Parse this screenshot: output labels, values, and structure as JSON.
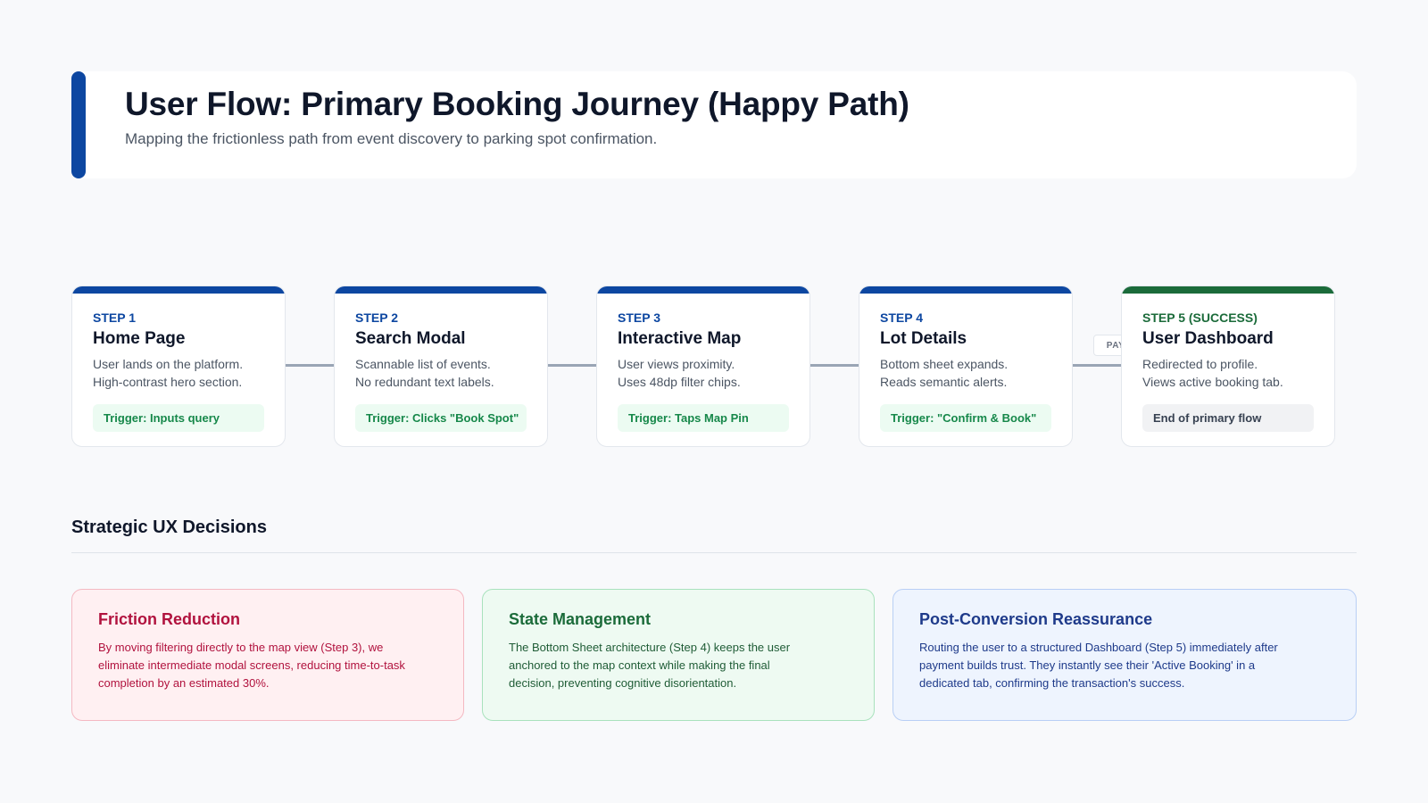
{
  "header": {
    "title": "User Flow: Primary Booking Journey (Happy Path)",
    "subtitle": "Mapping the frictionless path from event discovery to parking spot confirmation."
  },
  "flow": {
    "connector_label": "PAY",
    "steps": [
      {
        "label": "STEP 1",
        "title": "Home Page",
        "desc_line1": "User lands on the platform.",
        "desc_line2": "High-contrast hero section.",
        "trigger": "Trigger: Inputs query"
      },
      {
        "label": "STEP 2",
        "title": "Search Modal",
        "desc_line1": "Scannable list of events.",
        "desc_line2": "No redundant text labels.",
        "trigger": "Trigger: Clicks \"Book Spot\""
      },
      {
        "label": "STEP 3",
        "title": "Interactive Map",
        "desc_line1": "User views proximity.",
        "desc_line2": "Uses 48dp filter chips.",
        "trigger": "Trigger: Taps Map Pin"
      },
      {
        "label": "STEP 4",
        "title": "Lot Details",
        "desc_line1": "Bottom sheet expands.",
        "desc_line2": "Reads semantic alerts.",
        "trigger": "Trigger: \"Confirm & Book\""
      },
      {
        "label": "STEP 5 (SUCCESS)",
        "title": "User Dashboard",
        "desc_line1": "Redirected to profile.",
        "desc_line2": "Views active booking tab.",
        "trigger": "End of primary flow"
      }
    ]
  },
  "decisions": {
    "title": "Strategic UX Decisions",
    "cards": [
      {
        "title": "Friction Reduction",
        "text": "By moving filtering directly to the map view (Step 3), we eliminate intermediate modal screens, reducing time-to-task completion by an estimated 30%."
      },
      {
        "title": "State Management",
        "text": "The Bottom Sheet architecture (Step 4) keeps the user anchored to the map context while making the final decision, preventing cognitive disorientation."
      },
      {
        "title": "Post-Conversion Reassurance",
        "text": "Routing the user to a structured Dashboard (Step 5) immediately after payment builds trust. They instantly see their 'Active Booking' in a dedicated tab, confirming the transaction's success."
      }
    ]
  },
  "colors": {
    "primary": "#0d47a1",
    "success": "#1b6b3a",
    "trigger_text": "#16884a",
    "red_accent": "#b1123e",
    "blue_accent": "#1e3a8a"
  }
}
